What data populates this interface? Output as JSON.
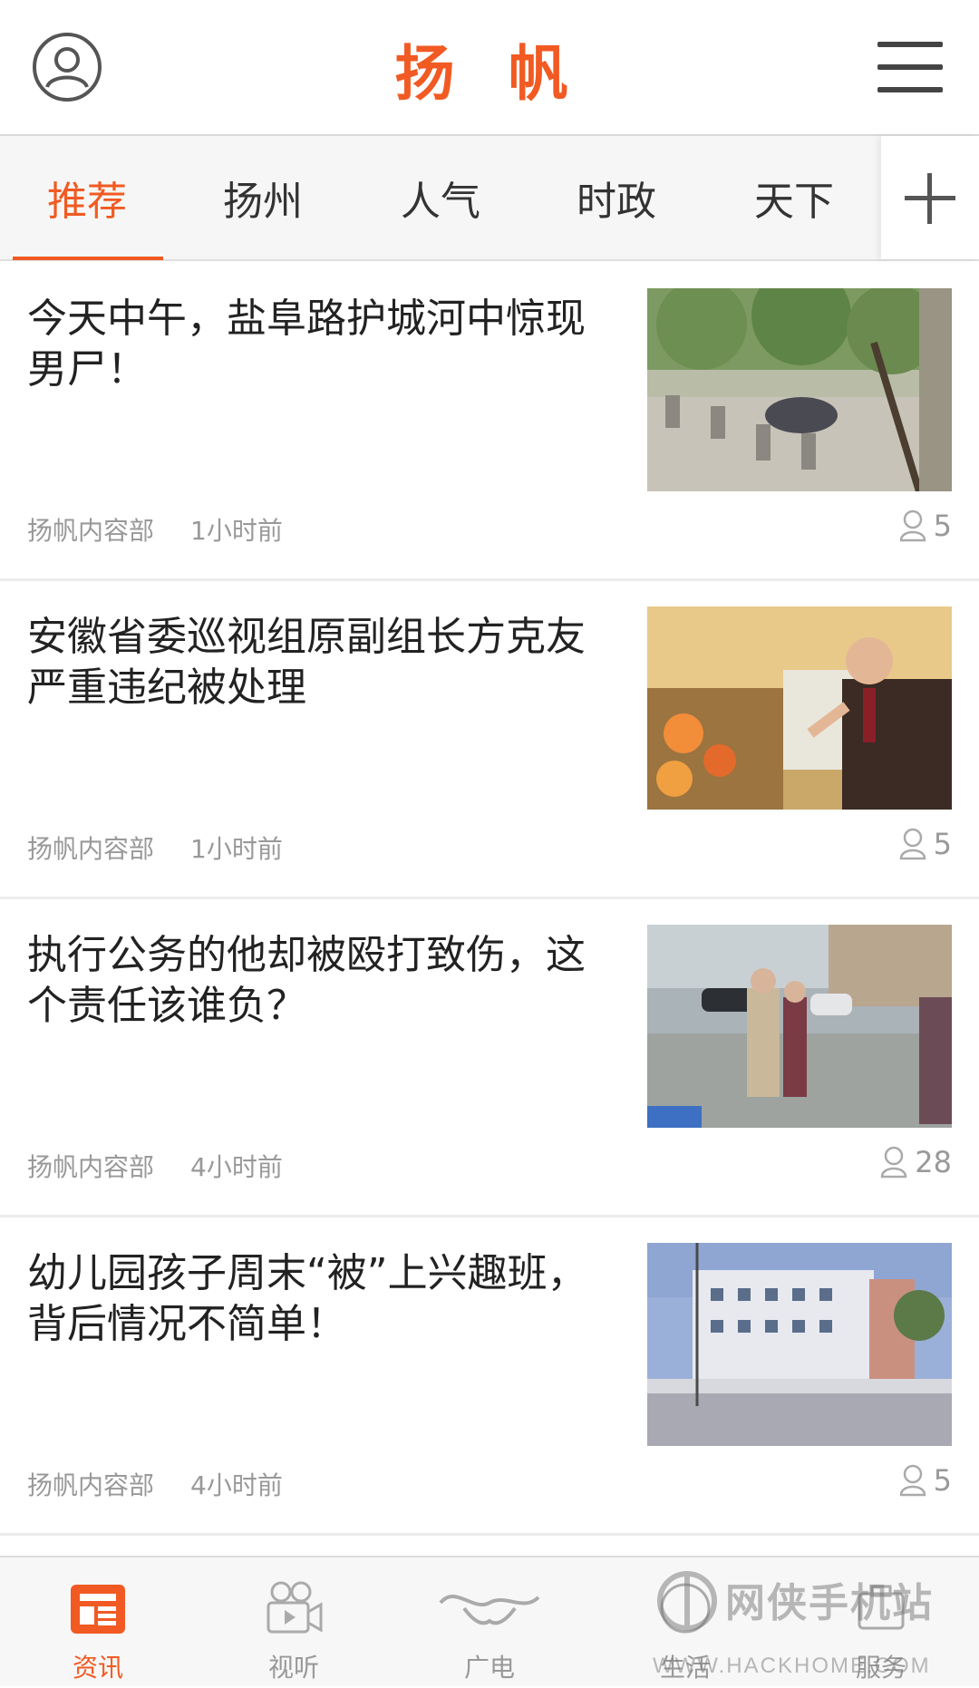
{
  "header": {
    "logo": "扬 帆",
    "avatar_icon": "user-avatar-icon",
    "menu_icon": "hamburger-menu-icon"
  },
  "tabs": [
    {
      "label": "推荐",
      "active": true
    },
    {
      "label": "扬州",
      "active": false
    },
    {
      "label": "人气",
      "active": false
    },
    {
      "label": "时政",
      "active": false
    },
    {
      "label": "天下",
      "active": false
    }
  ],
  "news": [
    {
      "title": "今天中午，盐阜路护城河中惊现男尸！",
      "source": "扬帆内容部",
      "time": "1小时前",
      "count": "5",
      "thumb": "park-riverside-photo"
    },
    {
      "title": "安徽省委巡视组原副组长方克友严重违纪被处理",
      "source": "扬帆内容部",
      "time": "1小时前",
      "count": "5",
      "thumb": "official-speaking-photo"
    },
    {
      "title": "执行公务的他却被殴打致伤，这个责任该谁负？",
      "source": "扬帆内容部",
      "time": "4小时前",
      "count": "28",
      "thumb": "street-scene-photo"
    },
    {
      "title": "幼儿园孩子周末“被”上兴趣班，背后情况不简单！",
      "source": "扬帆内容部",
      "time": "4小时前",
      "count": "5",
      "thumb": "building-photo"
    }
  ],
  "bottom_nav": [
    {
      "label": "资讯",
      "icon": "news-icon",
      "active": true
    },
    {
      "label": "视听",
      "icon": "video-camera-icon",
      "active": false
    },
    {
      "label": "广电",
      "icon": "broadcast-icon",
      "active": false
    },
    {
      "label": "生活",
      "icon": "life-icon",
      "active": false
    },
    {
      "label": "服务",
      "icon": "service-icon",
      "active": false
    }
  ],
  "watermark": {
    "title": "网侠手机站",
    "url": "WWW.HACKHOME.COM"
  },
  "colors": {
    "accent": "#f15a22",
    "text": "#222222",
    "meta": "#999999"
  }
}
